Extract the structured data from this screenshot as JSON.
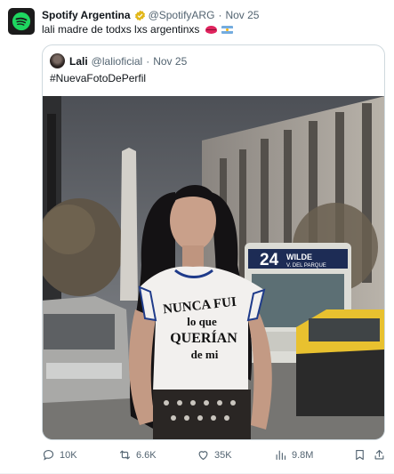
{
  "tweet": {
    "author_name": "Spotify Argentina",
    "author_handle": "@SpotifyARG",
    "separator": "·",
    "date": "Nov 25",
    "text": "lali madre de todxs lxs argentinxs",
    "emojis": [
      "lips-emoji",
      "argentina-flag-emoji"
    ]
  },
  "quoted": {
    "author_name": "Lali",
    "author_handle": "@lalioficial",
    "separator": "·",
    "date": "Nov 25",
    "text": "#NuevaFotoDePerfil",
    "photo": {
      "shirt_text_line1": "NUNCA FUI",
      "shirt_text_line2": "lo que",
      "shirt_text_line3": "QUERÍAN",
      "shirt_text_line4": "de mi",
      "bus_route": "24",
      "bus_sign_line1": "WILDE",
      "bus_sign_line2": "V. DEL PARQUE"
    }
  },
  "actions": {
    "replies": "10K",
    "retweets": "6.6K",
    "likes": "35K",
    "views": "9.8M"
  },
  "colors": {
    "spotify_green": "#1ed760",
    "text_primary": "#0f1419",
    "text_muted": "#536471",
    "border": "#cfd9de"
  }
}
